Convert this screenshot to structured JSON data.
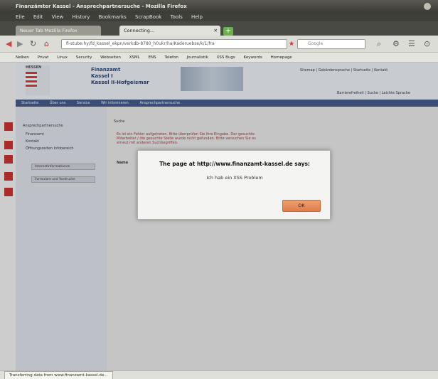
{
  "window": {
    "title": "Finanzämter Kassel - Ansprechpartnersuche - Mozilla Firefox"
  },
  "menu": [
    "Eile",
    "Edit",
    "View",
    "History",
    "Bookmarks",
    "ScrapBook",
    "Tools",
    "Help"
  ],
  "tabs": [
    {
      "label": "Neuer Tab Mozilla Firefox"
    },
    {
      "label": "Connecting..."
    }
  ],
  "newtab_symbol": "+",
  "address": {
    "url": "fi-stube.hy/fd_kassel_ekpn/verkdb-8780_h0ukr/ha/Kaderuebse/k/1/fra",
    "search_placeholder": "Google"
  },
  "bookmarks": [
    "Nelken",
    "Privat",
    "Linux",
    "Security",
    "Webseiten",
    "XSML",
    "ENS",
    "Telefon",
    "Journalistik",
    "XSS Bugs",
    "Keywords",
    "Homepage"
  ],
  "site": {
    "logo_text": "HESSEN",
    "org_line1": "Finanzamt",
    "org_line2": "Kassel I",
    "org_line3": "Kassel II-Hofgeismar",
    "top_links": "Sitemap  |  Gebärdensprache  |  Startseite  |  Kontakt",
    "header_tabs": "Barrierefreiheit  |  Suche  |  Leichte Sprache",
    "nav": [
      "Startseite",
      "Über uns",
      "Service",
      "Wir informieren",
      "Ansprechpartnersuche"
    ]
  },
  "sidebar": {
    "title": "Ansprechpartnersuche",
    "items": [
      "Finanzamt",
      "Kontakt",
      "Öffnungszeiten Infobereich"
    ],
    "buttons": [
      "Internetinformationen",
      "Formulare und Vordrucke"
    ]
  },
  "content": {
    "title": "Suche",
    "warning": "Es ist ein Fehler aufgetreten. Bitte überprüfen Sie Ihre Eingabe. Der gesuchte Mitarbeiter / die gesuchte Stelle wurde nicht gefunden. Bitte versuchen Sie es erneut mit anderen Suchbegriffen.",
    "label": "Name"
  },
  "dialog": {
    "title": "The page at http://www.finanzamt-kassel.de says:",
    "message": "Ich hab ein XSS Problem",
    "ok_label": "OK"
  },
  "status": {
    "text": "Transferring data from www.finanzamt-kassel.de..."
  }
}
